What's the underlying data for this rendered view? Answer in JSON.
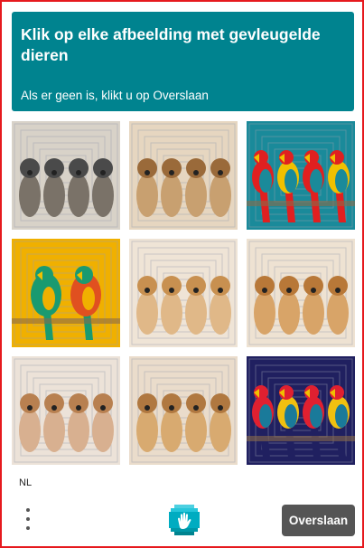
{
  "header": {
    "title": "Klik op elke afbeelding met gevleugelde dieren",
    "subtitle": "Als er geen is, klikt u op Overslaan",
    "background": "#00838f"
  },
  "grid": {
    "tiles": [
      {
        "subject": "dogs",
        "palette": [
          "#4a4a4a",
          "#7a7268",
          "#d8d2c8"
        ]
      },
      {
        "subject": "dogs",
        "palette": [
          "#9a6a3a",
          "#c8a070",
          "#e6d6c0"
        ]
      },
      {
        "subject": "parrots",
        "palette": [
          "#e02020",
          "#f0c000",
          "#1a8a9a"
        ]
      },
      {
        "subject": "parrots",
        "palette": [
          "#1a9a70",
          "#e05020",
          "#f0b000"
        ]
      },
      {
        "subject": "dogs",
        "palette": [
          "#c89050",
          "#e0b888",
          "#efe4d6"
        ]
      },
      {
        "subject": "dogs",
        "palette": [
          "#b87838",
          "#d8a468",
          "#eee2d2"
        ]
      },
      {
        "subject": "dogs",
        "palette": [
          "#b88050",
          "#d8b090",
          "#ece2d8"
        ]
      },
      {
        "subject": "dogs",
        "palette": [
          "#b07840",
          "#d8aa70",
          "#eadccb"
        ]
      },
      {
        "subject": "parrots",
        "palette": [
          "#e02030",
          "#f0c010",
          "#202060"
        ]
      }
    ]
  },
  "footer": {
    "language": "NL",
    "menu_icon": "vertical-ellipsis-icon",
    "logo_icon": "hcaptcha-logo-icon",
    "skip_label": "Overslaan"
  }
}
